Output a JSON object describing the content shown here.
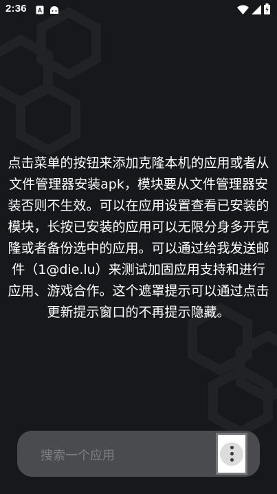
{
  "status_bar": {
    "time": "2:36",
    "icons": [
      "a-notification-icon",
      "android-icon",
      "wifi-icon",
      "signal-icon",
      "battery-icon"
    ]
  },
  "overlay": {
    "hint": "点击菜单的按钮来添加克隆本机的应用或者从文件管理器安装apk，模块要从文件管理器安装否则不生效。可以在应用设置查看已安装的模块，长按已安装的应用可以无限分身多开克隆或者备份选中的应用。可以通过给我发送邮件（1@die.lu）来测试加固应用支持和进行应用、游戏合作。这个遮罩提示可以通过点击更新提示窗口的不再提示隐藏。"
  },
  "search": {
    "placeholder": "搜索一个应用",
    "menu_icon": "more-vertical-icon"
  },
  "colors": {
    "background": "#17181b",
    "search_bg": "#4a4b4e",
    "placeholder": "#7e7f82",
    "text": "#ffffff"
  }
}
